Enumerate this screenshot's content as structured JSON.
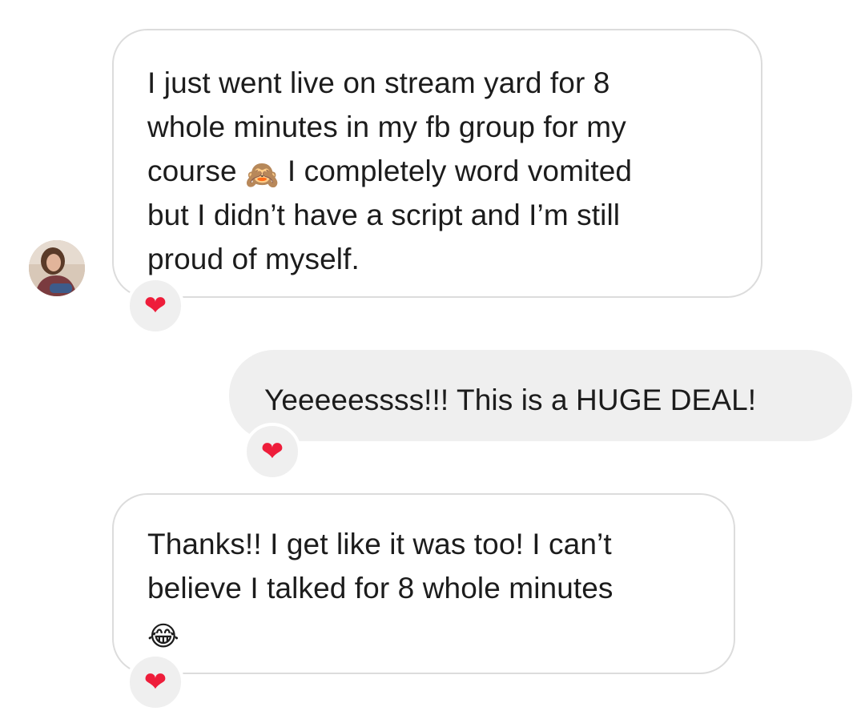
{
  "conversation": {
    "messages": [
      {
        "direction": "incoming",
        "text_before_emoji": "I just went live on stream yard for 8\nwhole minutes in my fb group for my\ncourse ",
        "emoji": "🙈",
        "emoji_name": "see-no-evil-monkey-icon",
        "text_after_emoji": " I completely word vomited\nbut I didn’t have a script and I’m still\nproud of myself.",
        "reaction": "❤"
      },
      {
        "direction": "outgoing",
        "text": "Yeeeeessss!!! This is a HUGE DEAL!",
        "reaction": "❤"
      },
      {
        "direction": "incoming",
        "text": "Thanks!! I get like it was too! I can’t\nbelieve I talked for 8 whole minutes\n",
        "emoji": "😂",
        "emoji_name": "tears-of-joy-icon",
        "reaction": "❤"
      }
    ]
  },
  "colors": {
    "incoming_border": "#dcdcdc",
    "outgoing_bg": "#efefef",
    "heart": "#ee1d3a",
    "text": "#1c1c1c"
  },
  "icons": {
    "reaction": "heart-icon",
    "avatar": "user-avatar"
  }
}
